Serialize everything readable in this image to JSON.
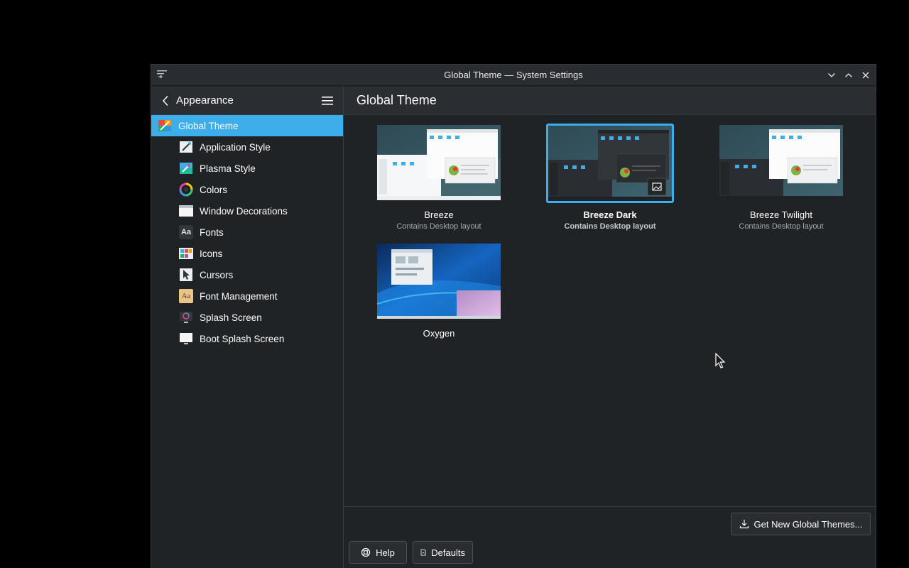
{
  "window": {
    "title": "Global Theme — System Settings"
  },
  "sidebar": {
    "header": "Appearance",
    "items": [
      {
        "label": "Global Theme",
        "icon": "global-theme-icon",
        "active": true
      },
      {
        "label": "Application Style",
        "icon": "application-style-icon"
      },
      {
        "label": "Plasma Style",
        "icon": "plasma-style-icon"
      },
      {
        "label": "Colors",
        "icon": "colors-icon"
      },
      {
        "label": "Window Decorations",
        "icon": "window-decorations-icon"
      },
      {
        "label": "Fonts",
        "icon": "fonts-icon"
      },
      {
        "label": "Icons",
        "icon": "icons-icon"
      },
      {
        "label": "Cursors",
        "icon": "cursors-icon"
      },
      {
        "label": "Font Management",
        "icon": "font-management-icon"
      },
      {
        "label": "Splash Screen",
        "icon": "splash-screen-icon"
      },
      {
        "label": "Boot Splash Screen",
        "icon": "boot-splash-screen-icon"
      }
    ],
    "fonts_icon_text": "Aa",
    "font_mgmt_icon_text": "Aa"
  },
  "main": {
    "title": "Global Theme",
    "themes": [
      {
        "name": "Breeze",
        "description": "Contains Desktop layout",
        "selected": false
      },
      {
        "name": "Breeze Dark",
        "description": "Contains Desktop layout",
        "selected": true
      },
      {
        "name": "Breeze Twilight",
        "description": "Contains Desktop layout",
        "selected": false
      },
      {
        "name": "Oxygen",
        "description": "",
        "selected": false
      }
    ]
  },
  "footer": {
    "get_new_label": "Get New Global Themes...",
    "help_label": "Help",
    "defaults_label": "Defaults"
  },
  "colors": {
    "accent": "#3daee9",
    "window_bg": "#202326",
    "header_bg": "#2a2e32",
    "text": "#fcfcfc",
    "muted_text": "#a1a9b1"
  }
}
